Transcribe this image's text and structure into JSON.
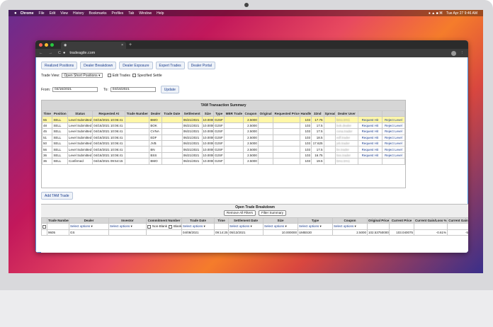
{
  "os_menubar": {
    "apple": "",
    "items": [
      "Chrome",
      "File",
      "Edit",
      "View",
      "History",
      "Bookmarks",
      "Profiles",
      "Tab",
      "Window",
      "Help"
    ],
    "clock": "Tue Apr 27  9:46 AM"
  },
  "browser": {
    "tab_title": "",
    "tab_close": "×",
    "new_tab": "+",
    "url": "tradeagile.com",
    "back": "←",
    "forward": "→",
    "reload": "C"
  },
  "nav_buttons": [
    "Realized Positions",
    "Dealer Breakdown",
    "Dealer Exposure",
    "Expert Trades",
    "Dealer Portal"
  ],
  "filters": {
    "trade_view_label": "Trade View:",
    "trade_view_value": "Open Short Positions",
    "edit_trades": "Edit Trades",
    "specified_settle": "Specified Settle",
    "from_label": "From:",
    "from_value": "04/16/2021",
    "to_label": "To:",
    "to_value": "04/16/2021",
    "update": "Update"
  },
  "tam_summary": {
    "title": "TAM Transaction Summary",
    "headers": [
      "Time",
      "Position",
      "Status",
      "Requested At",
      "Trade Number",
      "Dealer",
      "Trade Date",
      "Settlement",
      "Size",
      "Type",
      "MBR Trade",
      "Coupon",
      "Original",
      "Requested Price",
      "Handle",
      "32nd",
      "Spread",
      "Dealer User",
      "",
      ""
    ],
    "rows": [
      [
        "55",
        "SELL",
        "Level Submitted",
        "04/16/2021 10:06:41",
        "",
        "BMO",
        "",
        "06/21/2021",
        "10.0000",
        "G2SF",
        "",
        "2.5000",
        "",
        "",
        "103",
        "17.75",
        "",
        "bmo.trm1",
        "Request Hit",
        "Reject Level"
      ],
      [
        "48",
        "SELL",
        "Level Submitted",
        "04/16/2021 10:06:41",
        "",
        "BOK",
        "",
        "06/21/2021",
        "10.0000",
        "G2SF",
        "",
        "2.5000",
        "",
        "",
        "103",
        "17.5",
        "",
        "bok.dealer",
        "Request Hit",
        "Reject Level"
      ],
      [
        "45",
        "SELL",
        "Level Submitted",
        "04/16/2021 10:06:41",
        "",
        "CVNA",
        "",
        "06/21/2021",
        "10.0000",
        "G2SF",
        "",
        "2.5000",
        "",
        "",
        "103",
        "17.5",
        "",
        "cvna.trader",
        "Request Hit",
        "Reject Level"
      ],
      [
        "51",
        "SELL",
        "Level Submitted",
        "04/16/2021 10:06:41",
        "",
        "EDF",
        "",
        "06/21/2021",
        "10.0000",
        "G2SF",
        "",
        "2.5000",
        "",
        "",
        "103",
        "18.5",
        "",
        "edf.trader",
        "Request Hit",
        "Reject Level"
      ],
      [
        "50",
        "SELL",
        "Level Submitted",
        "04/16/2021 10:06:41",
        "",
        "JVB",
        "",
        "06/21/2021",
        "10.0000",
        "G2SF",
        "",
        "2.5000",
        "",
        "",
        "103",
        "17.625",
        "",
        "jvb.trader",
        "Request Hit",
        "Reject Level"
      ],
      [
        "56",
        "SELL",
        "Level Submitted",
        "04/16/2021 10:06:41",
        "",
        "BN",
        "",
        "06/21/2021",
        "10.0000",
        "G2SF",
        "",
        "2.5000",
        "",
        "",
        "103",
        "17.5",
        "",
        "bn.trader",
        "Request Hit",
        "Reject Level"
      ],
      [
        "36",
        "SELL",
        "Level Submitted",
        "04/16/2021 10:06:41",
        "",
        "BSS",
        "",
        "06/21/2021",
        "10.0000",
        "G2SF",
        "",
        "2.5000",
        "",
        "",
        "103",
        "16.75",
        "",
        "bss.trader",
        "Request Hit",
        "Reject Level"
      ],
      [
        "36",
        "SELL",
        "Confirmed",
        "04/16/2021 09:54:15",
        "",
        "BMO",
        "",
        "06/21/2021",
        "10.0000",
        "G2SF",
        "",
        "2.5000",
        "",
        "",
        "103",
        "19.5",
        "",
        "bmo.trm1",
        "",
        ""
      ]
    ]
  },
  "add_tam": "Add TAM Trade",
  "open_breakdown": {
    "title": "Open Trade Breakdown",
    "remove_filters": "Remove All Filters",
    "filter_summary": "Filter Summary",
    "headers": [
      "",
      "Trade Number",
      "Dealer",
      "Investor",
      "Commitment Number",
      "Trade Date",
      "Time",
      "Settlement Date",
      "Size",
      "Type",
      "Coupon",
      "Original Price",
      "Current Price",
      "Current Gain/Loss %",
      "Current Gain"
    ],
    "select_options": "Select options",
    "non_blank": "Non-Blank",
    "blank": "Blank",
    "row": [
      "",
      "9605",
      "GS",
      "",
      "",
      "04/08/2021",
      "09:14:25",
      "05/13/2021",
      "10.000000",
      "UMBS30",
      "2.5000",
      "102.53750000",
      "103.040075",
      "-0.61%",
      "-5"
    ]
  }
}
